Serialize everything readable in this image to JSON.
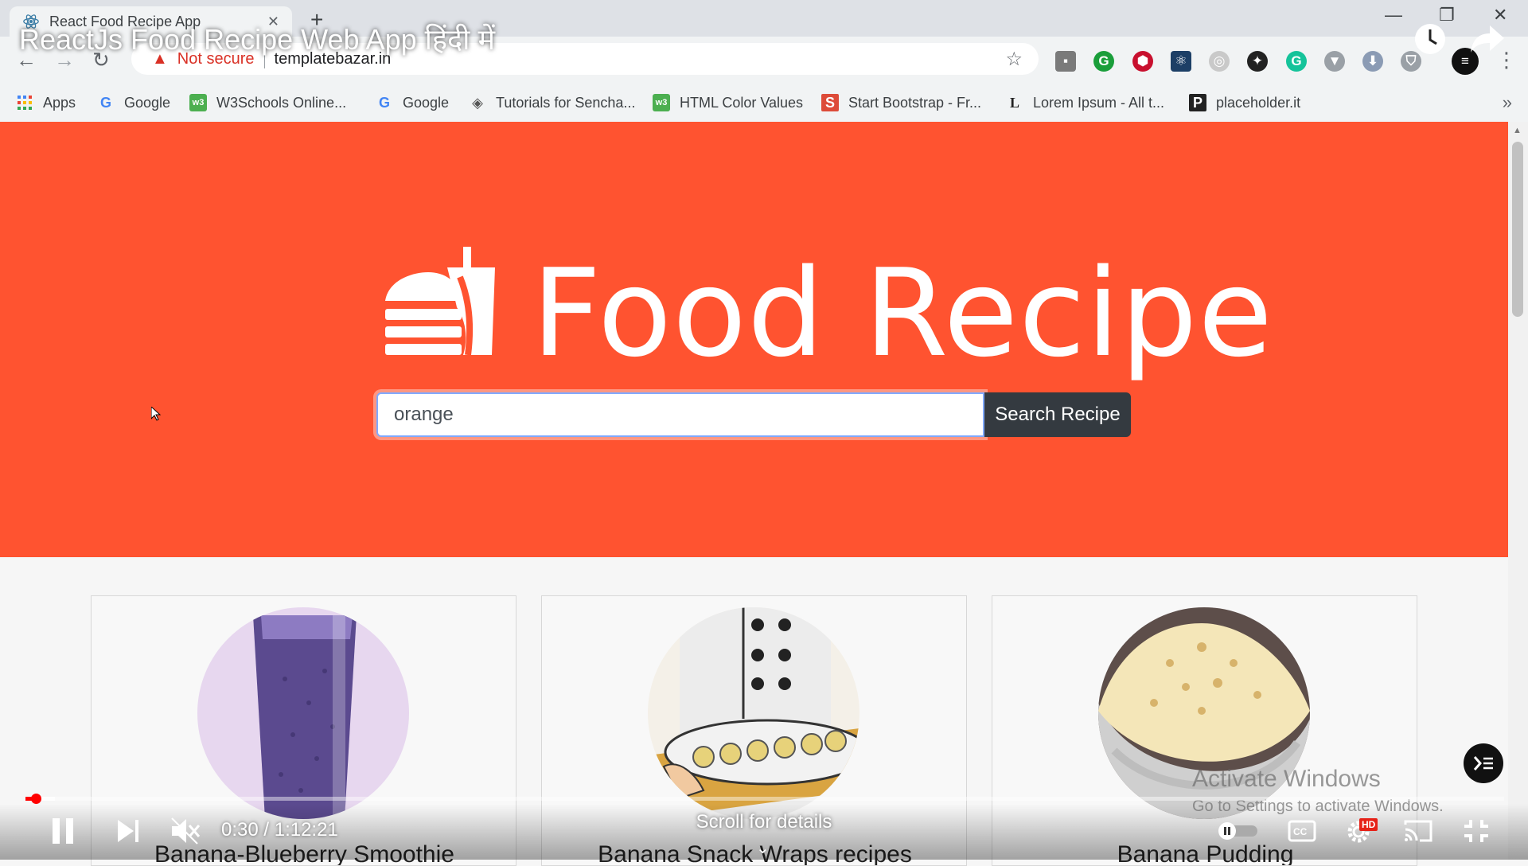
{
  "browser": {
    "tab_title": "React Food Recipe App",
    "security_label": "Not secure",
    "url": "templatebazar.in",
    "bookmarks": [
      {
        "label": "Apps"
      },
      {
        "label": "Google"
      },
      {
        "label": "W3Schools Online..."
      },
      {
        "label": "Google"
      },
      {
        "label": "Tutorials for Sencha..."
      },
      {
        "label": "HTML Color Values"
      },
      {
        "label": "Start Bootstrap - Fr..."
      },
      {
        "label": "Lorem Ipsum - All t..."
      },
      {
        "label": "placeholder.it"
      }
    ]
  },
  "video": {
    "title": "ReactJs Food Recipe Web App हिंदी में",
    "time": "0:30 / 1:12:21",
    "progress_fraction": 0.007,
    "scroll_hint": "Scroll for details",
    "hd_badge": "HD"
  },
  "app": {
    "brand": "Food Recipe",
    "search_value": "orange",
    "search_button": "Search Recipe",
    "hero_color": "#ff5330",
    "button_color": "#343a40"
  },
  "recipes": [
    {
      "title": "Banana-Blueberry Smoothie"
    },
    {
      "title": "Banana Snack Wraps recipes"
    },
    {
      "title": "Banana Pudding"
    }
  ],
  "watermark": {
    "line1": "Activate Windows",
    "line2": "Go to Settings to activate Windows."
  }
}
